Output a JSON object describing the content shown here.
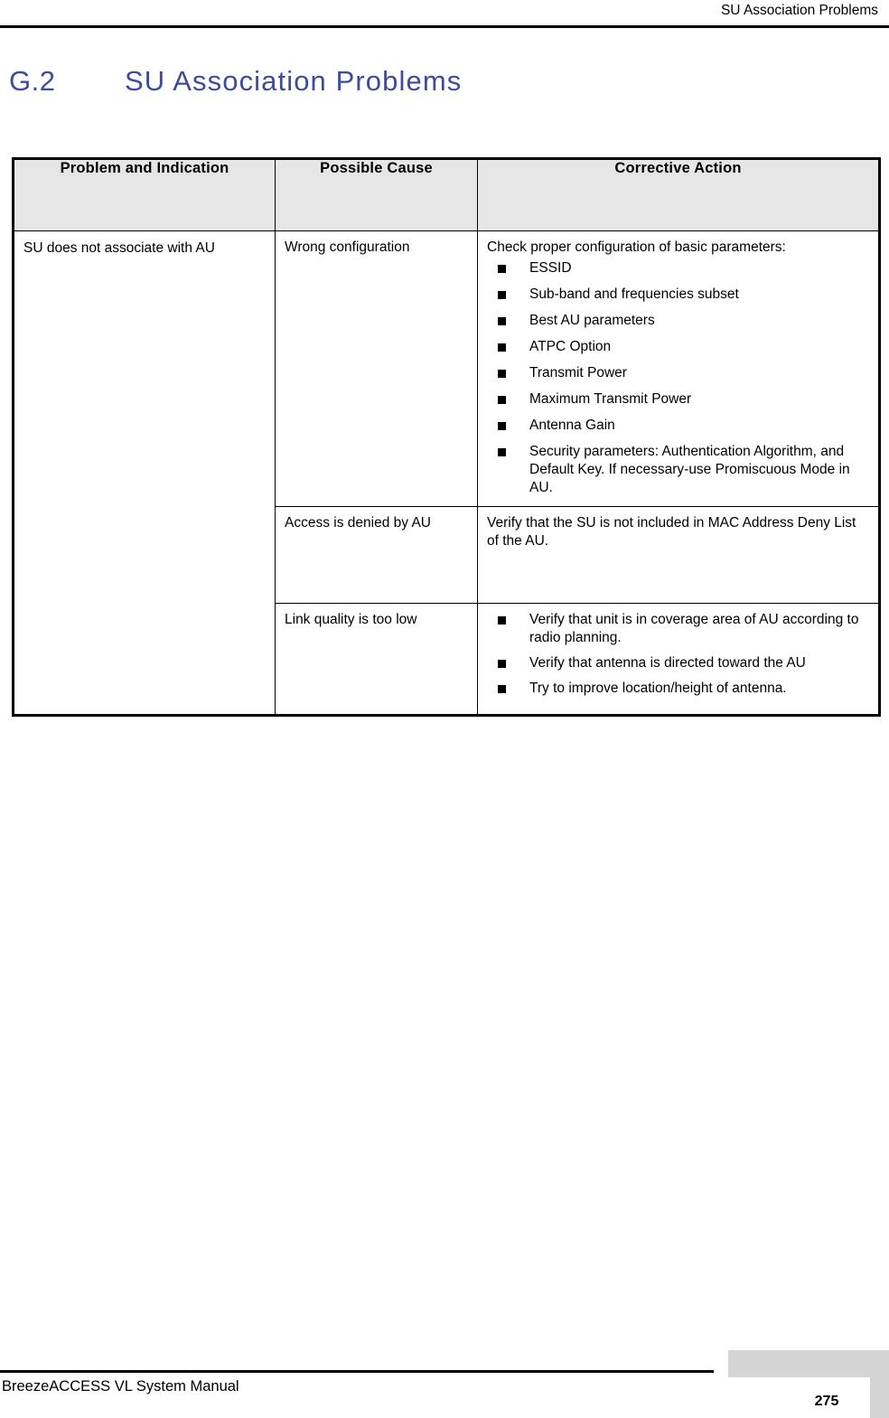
{
  "page": {
    "running_header": "SU Association Problems",
    "heading_number": "G.2",
    "heading_title": "SU Association Problems",
    "footer_manual": "BreezeACCESS VL System Manual",
    "page_number": "275",
    "colors": {
      "heading_blue": "#3c4b9e",
      "table_header_bg": "#e6e6e6",
      "footer_block_gray": "#d4d4d4",
      "rule_black": "#000000"
    }
  },
  "table": {
    "columns": [
      "Problem and Indication",
      "Possible Cause",
      "Corrective Action"
    ],
    "rows": [
      {
        "problem": "SU does not associate with AU",
        "cause": "Wrong configuration",
        "action_intro": "Check proper configuration of basic parameters:",
        "action_bullets": [
          "ESSID",
          "Sub-band and frequencies subset",
          "Best AU parameters",
          "ATPC Option",
          "Transmit Power",
          "Maximum Transmit Power",
          "Antenna Gain",
          "Security parameters: Authentication Algorithm, and Default Key. If necessary-use Promiscuous Mode in AU."
        ]
      },
      {
        "cause": "Access is denied by AU",
        "action_intro": "Verify that the SU is not included in MAC Address Deny List of the AU.",
        "action_bullets": []
      },
      {
        "cause": "Link quality is too low",
        "action_intro": "",
        "action_bullets": [
          "Verify that unit is in coverage area of AU according to radio planning.",
          "Verify that antenna is directed toward the AU",
          "Try to improve location/height of antenna."
        ]
      }
    ]
  }
}
